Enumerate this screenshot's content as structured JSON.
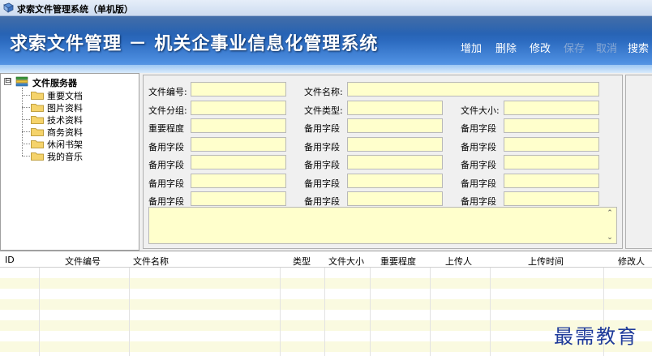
{
  "window": {
    "title": "求索文件管理系统（单机版）"
  },
  "header": {
    "heading": "求索文件管理 － 机关企事业信息化管理系统",
    "toolbar": [
      {
        "label": "增加",
        "enabled": true
      },
      {
        "label": "删除",
        "enabled": true
      },
      {
        "label": "修改",
        "enabled": true
      },
      {
        "label": "保存",
        "enabled": false
      },
      {
        "label": "取消",
        "enabled": false
      },
      {
        "label": "搜索",
        "enabled": true
      }
    ]
  },
  "tree": {
    "root": {
      "expander": "⊟",
      "label": "文件服务器",
      "icon": "server-icon"
    },
    "items": [
      {
        "label": "重要文档",
        "icon": "folder-icon"
      },
      {
        "label": "图片资料",
        "icon": "folder-icon"
      },
      {
        "label": "技术资料",
        "icon": "folder-icon"
      },
      {
        "label": "商务资料",
        "icon": "folder-icon"
      },
      {
        "label": "休闲书架",
        "icon": "folder-icon"
      },
      {
        "label": "我的音乐",
        "icon": "folder-icon"
      }
    ]
  },
  "form": {
    "rows": [
      [
        {
          "label": "文件编号:",
          "value": ""
        },
        {
          "label": "文件名称:",
          "value": ""
        }
      ],
      [
        {
          "label": "文件分组:",
          "value": ""
        },
        {
          "label": "文件类型:",
          "value": ""
        },
        {
          "label": "文件大小:",
          "value": ""
        }
      ],
      [
        {
          "label": "重要程度",
          "value": ""
        },
        {
          "label": "备用字段",
          "value": ""
        },
        {
          "label": "备用字段",
          "value": ""
        }
      ],
      [
        {
          "label": "备用字段",
          "value": ""
        },
        {
          "label": "备用字段",
          "value": ""
        },
        {
          "label": "备用字段",
          "value": ""
        }
      ],
      [
        {
          "label": "备用字段",
          "value": ""
        },
        {
          "label": "备用字段",
          "value": ""
        },
        {
          "label": "备用字段",
          "value": ""
        }
      ],
      [
        {
          "label": "备用字段",
          "value": ""
        },
        {
          "label": "备用字段",
          "value": ""
        },
        {
          "label": "备用字段",
          "value": ""
        }
      ],
      [
        {
          "label": "备用字段",
          "value": ""
        },
        {
          "label": "备用字段",
          "value": ""
        },
        {
          "label": "备用字段",
          "value": ""
        }
      ]
    ],
    "memo": {
      "value": "",
      "scroll_up": "⌃",
      "scroll_down": "⌄"
    }
  },
  "grid": {
    "columns": [
      "ID",
      "文件编号",
      "文件名称",
      "类型",
      "文件大小",
      "重要程度",
      "上传人",
      "上传时间",
      "修改人"
    ],
    "rows": []
  },
  "watermark": "最需教育",
  "colors": {
    "banner": "#2d6cc1",
    "input_bg": "#ffffcc",
    "row_alt": "#fafae0"
  }
}
